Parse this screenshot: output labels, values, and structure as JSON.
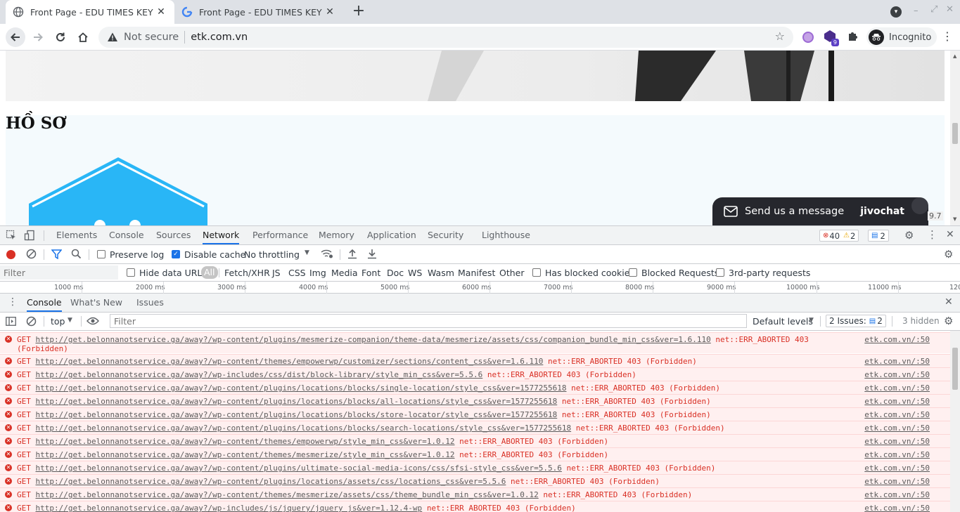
{
  "browser": {
    "tabs": [
      {
        "title": "Front Page - EDU TIMES KEY GL",
        "active": true
      },
      {
        "title": "Front Page - EDU TIMES KEY GL",
        "active": false
      }
    ],
    "new_tab": "+",
    "address": {
      "security": "Not secure",
      "url": "etk.com.vn"
    },
    "profile": "Incognito",
    "extension_badge": "9"
  },
  "page": {
    "heading": "HỒ SƠ",
    "chat": {
      "label": "Send us a message",
      "brand": "jivochat"
    },
    "corner_text": "9.7"
  },
  "devtools": {
    "panels": [
      "Elements",
      "Console",
      "Sources",
      "Network",
      "Performance",
      "Memory",
      "Application",
      "Security",
      "Lighthouse"
    ],
    "selected_panel": "Network",
    "counters": {
      "errors": "40",
      "warnings": "2",
      "messages": "2"
    },
    "network": {
      "preserve_log": "Preserve log",
      "disable_cache": "Disable cache",
      "throttling": "No throttling",
      "filter_placeholder": "Filter",
      "hide_data_urls": "Hide data URLs",
      "types": [
        "All",
        "Fetch/XHR",
        "JS",
        "CSS",
        "Img",
        "Media",
        "Font",
        "Doc",
        "WS",
        "Wasm",
        "Manifest",
        "Other"
      ],
      "has_blocked_cookies": "Has blocked cookies",
      "blocked_requests": "Blocked Requests",
      "third_party": "3rd-party requests",
      "timeline_ticks": [
        "1000 ms",
        "2000 ms",
        "3000 ms",
        "4000 ms",
        "5000 ms",
        "6000 ms",
        "7000 ms",
        "8000 ms",
        "9000 ms",
        "10000 ms",
        "11000 ms",
        "120"
      ]
    },
    "drawer": {
      "tabs": [
        "Console",
        "What's New",
        "Issues"
      ],
      "context": "top",
      "filter_placeholder": "Filter",
      "levels": "Default levels",
      "issues_label": "2 Issues:",
      "issues_count": "2",
      "hidden": "3 hidden"
    },
    "console_messages": [
      {
        "method": "GET",
        "url": "http://get.belonnanotservice.ga/away?/wp-content/plugins/mesmerize-companion/theme-data/mesmerize/assets/css/companion_bundle_min_css&ver=1.6.110",
        "error": "net::ERR_ABORTED 403",
        "status": "(Forbidden)",
        "source": "etk.com.vn/:50"
      },
      {
        "method": "GET",
        "url": "http://get.belonnanotservice.ga/away?/wp-content/themes/empowerwp/customizer/sections/content_css&ver=1.6.110",
        "error": "net::ERR_ABORTED 403 (Forbidden)",
        "status": "",
        "source": "etk.com.vn/:50"
      },
      {
        "method": "GET",
        "url": "http://get.belonnanotservice.ga/away?/wp-includes/css/dist/block-library/style_min_css&ver=5.5.6",
        "error": "net::ERR_ABORTED 403 (Forbidden)",
        "status": "",
        "source": "etk.com.vn/:50"
      },
      {
        "method": "GET",
        "url": "http://get.belonnanotservice.ga/away?/wp-content/plugins/locations/blocks/single-location/style_css&ver=1577255618",
        "error": "net::ERR_ABORTED 403 (Forbidden)",
        "status": "",
        "source": "etk.com.vn/:50"
      },
      {
        "method": "GET",
        "url": "http://get.belonnanotservice.ga/away?/wp-content/plugins/locations/blocks/all-locations/style_css&ver=1577255618",
        "error": "net::ERR_ABORTED 403 (Forbidden)",
        "status": "",
        "source": "etk.com.vn/:50"
      },
      {
        "method": "GET",
        "url": "http://get.belonnanotservice.ga/away?/wp-content/plugins/locations/blocks/store-locator/style_css&ver=1577255618",
        "error": "net::ERR_ABORTED 403 (Forbidden)",
        "status": "",
        "source": "etk.com.vn/:50"
      },
      {
        "method": "GET",
        "url": "http://get.belonnanotservice.ga/away?/wp-content/plugins/locations/blocks/search-locations/style_css&ver=1577255618",
        "error": "net::ERR_ABORTED 403 (Forbidden)",
        "status": "",
        "source": "etk.com.vn/:50"
      },
      {
        "method": "GET",
        "url": "http://get.belonnanotservice.ga/away?/wp-content/themes/empowerwp/style_min_css&ver=1.0.12",
        "error": "net::ERR_ABORTED 403 (Forbidden)",
        "status": "",
        "source": "etk.com.vn/:50"
      },
      {
        "method": "GET",
        "url": "http://get.belonnanotservice.ga/away?/wp-content/themes/mesmerize/style_min_css&ver=1.0.12",
        "error": "net::ERR_ABORTED 403 (Forbidden)",
        "status": "",
        "source": "etk.com.vn/:50"
      },
      {
        "method": "GET",
        "url": "http://get.belonnanotservice.ga/away?/wp-content/plugins/ultimate-social-media-icons/css/sfsi-style_css&ver=5.5.6",
        "error": "net::ERR_ABORTED 403 (Forbidden)",
        "status": "",
        "source": "etk.com.vn/:50"
      },
      {
        "method": "GET",
        "url": "http://get.belonnanotservice.ga/away?/wp-content/plugins/locations/assets/css/locations_css&ver=5.5.6",
        "error": "net::ERR_ABORTED 403 (Forbidden)",
        "status": "",
        "source": "etk.com.vn/:50"
      },
      {
        "method": "GET",
        "url": "http://get.belonnanotservice.ga/away?/wp-content/themes/mesmerize/assets/css/theme_bundle_min_css&ver=1.0.12",
        "error": "net::ERR_ABORTED 403 (Forbidden)",
        "status": "",
        "source": "etk.com.vn/:50"
      },
      {
        "method": "GET",
        "url": "http://get.belonnanotservice.ga/away?/wp-includes/js/jquery/jquery_js&ver=1.12.4-wp",
        "error": "net::ERR_ABORTED 403 (Forbidden)",
        "status": "",
        "source": "etk.com.vn/:50"
      }
    ],
    "colors": {
      "accent": "#1a73e8",
      "error": "#d93025",
      "error_bg": "#fff0f0",
      "hex_blue": "#29b6f6"
    }
  }
}
